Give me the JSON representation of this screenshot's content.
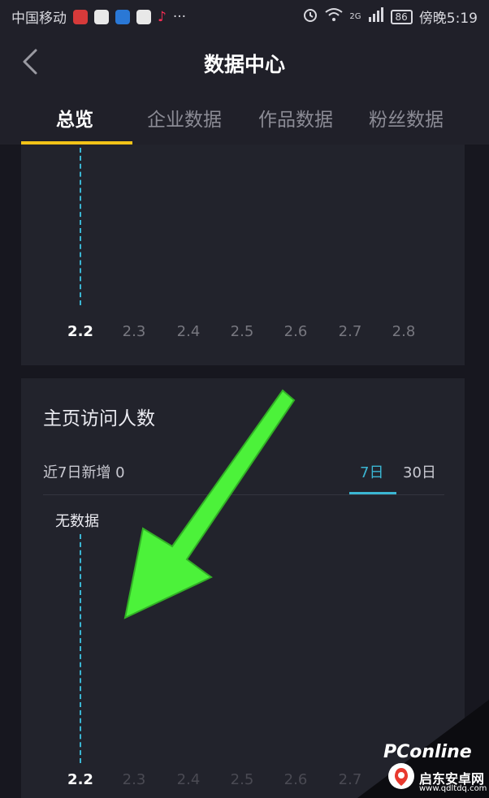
{
  "status_bar": {
    "carrier": "中国移动",
    "signal_label": "2G",
    "battery": "86",
    "time": "傍晚5:19",
    "more": "···"
  },
  "header": {
    "title": "数据中心"
  },
  "tabs": [
    {
      "label": "总览",
      "active": true
    },
    {
      "label": "企业数据",
      "active": false
    },
    {
      "label": "作品数据",
      "active": false
    },
    {
      "label": "粉丝数据",
      "active": false
    }
  ],
  "chart_top": {
    "x_ticks": [
      "2.2",
      "2.3",
      "2.4",
      "2.5",
      "2.6",
      "2.7",
      "2.8"
    ]
  },
  "visitors_card": {
    "title": "主页访问人数",
    "summary": "近7日新增 0",
    "range_tabs": [
      {
        "label": "7日",
        "active": true
      },
      {
        "label": "30日",
        "active": false
      }
    ],
    "empty_text": "无数据",
    "x_ticks": [
      "2.2",
      "2.3",
      "2.4",
      "2.5",
      "2.6",
      "2.7"
    ]
  },
  "watermark": {
    "brand": "PConline",
    "site_name": "启东安卓网",
    "url": "www.qdltdq.com"
  },
  "colors": {
    "accent_yellow": "#f2c318",
    "accent_cyan": "#3bb6d3",
    "arrow_green": "#4cf23a",
    "background": "#17171f",
    "card": "#22232c"
  }
}
